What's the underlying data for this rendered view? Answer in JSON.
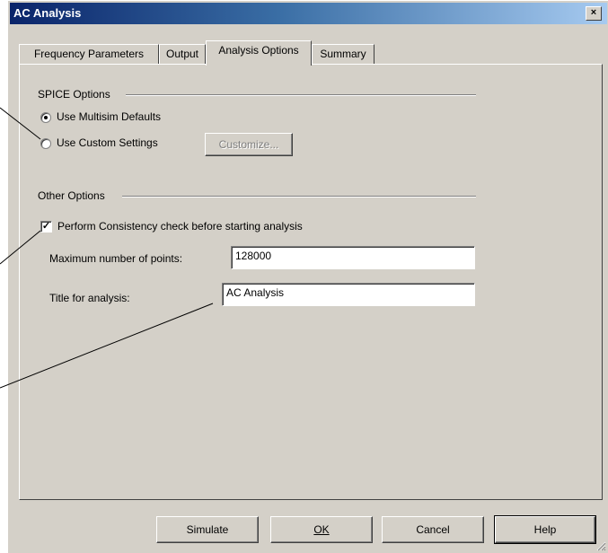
{
  "window": {
    "title": "AC Analysis",
    "close_glyph": "×"
  },
  "tabs": [
    {
      "label": "Frequency Parameters"
    },
    {
      "label": "Output"
    },
    {
      "label": "Analysis Options"
    },
    {
      "label": "Summary"
    }
  ],
  "spice_options": {
    "group_label": "SPICE Options",
    "use_defaults_label": "Use Multisim Defaults",
    "use_custom_label": "Use Custom Settings",
    "customize_label": "Customize..."
  },
  "other_options": {
    "group_label": "Other Options",
    "consistency_label": "Perform Consistency check before starting analysis",
    "consistency_checked": "✓",
    "max_points_label": "Maximum number of points:",
    "max_points_value": "128000",
    "title_label": "Title for analysis:",
    "title_value": "AC Analysis"
  },
  "buttons": {
    "simulate": "Simulate",
    "ok": "OK",
    "cancel": "Cancel",
    "help": "Help"
  },
  "colors": {
    "titlebar_start": "#0a246a",
    "titlebar_end": "#a6caf0",
    "face": "#d4d0c8"
  }
}
